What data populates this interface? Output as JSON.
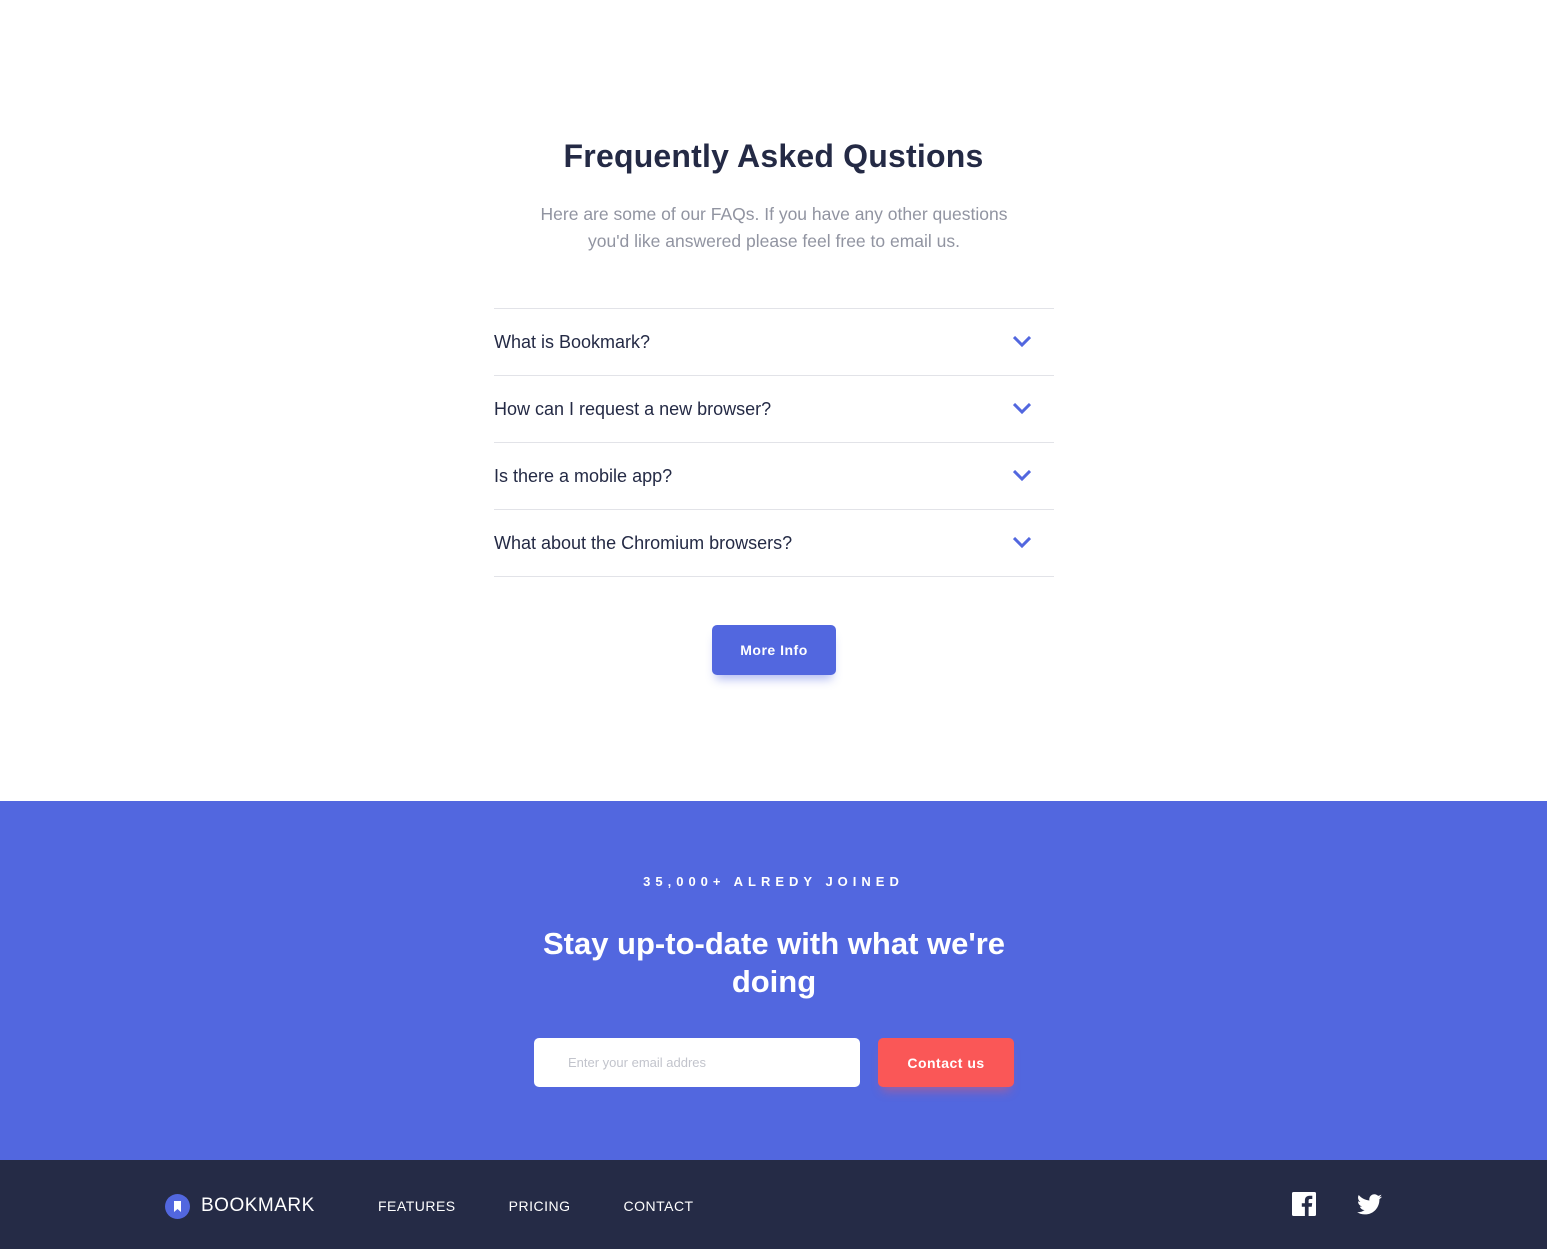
{
  "faq": {
    "title": "Frequently Asked Qustions",
    "subtitle": "Here are some of our FAQs. If you have any other questions you'd like answered please feel free to email us.",
    "items": [
      {
        "question": "What is Bookmark?"
      },
      {
        "question": "How can I request a new browser?"
      },
      {
        "question": "Is there a mobile app?"
      },
      {
        "question": "What about the Chromium browsers?"
      }
    ],
    "more_info_label": "More Info"
  },
  "cta": {
    "kicker": "35,000+ ALREDY JOINED",
    "heading": "Stay up-to-date with what we're doing",
    "email_placeholder": "Enter your email addres",
    "email_value": "",
    "contact_label": "Contact us"
  },
  "footer": {
    "logo_text": "BOOKMARK",
    "links": [
      {
        "label": "FEATURES"
      },
      {
        "label": "PRICING"
      },
      {
        "label": "CONTACT"
      }
    ],
    "icons": {
      "facebook": "facebook-icon",
      "twitter": "twitter-icon"
    }
  },
  "colors": {
    "primary_blue": "#5267df",
    "accent_red": "#fa5757",
    "dark_navy": "#252b46",
    "text_gray": "#9194a1"
  }
}
